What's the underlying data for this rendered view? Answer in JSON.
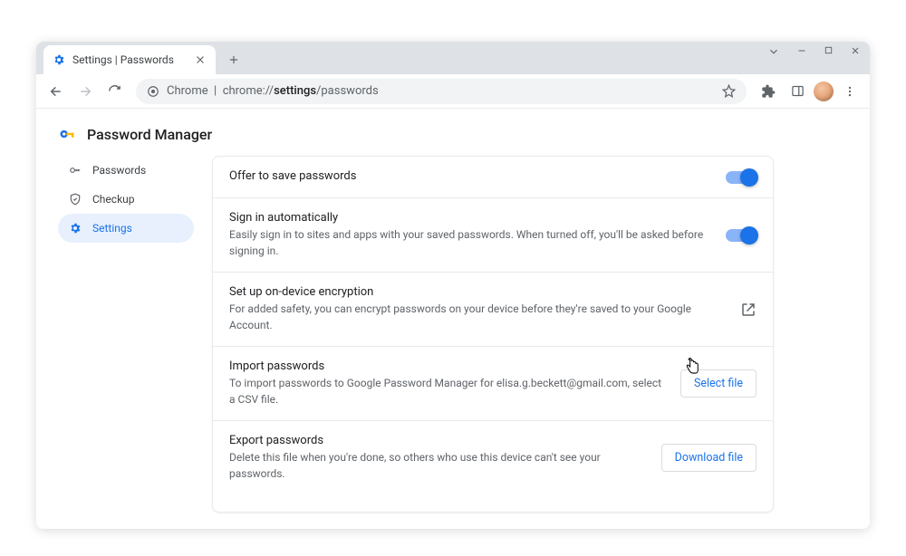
{
  "tab": {
    "title": "Settings | Passwords"
  },
  "omnibox": {
    "scheme": "Chrome",
    "path_prefix": "chrome://",
    "path_bold": "settings",
    "path_suffix": "/passwords"
  },
  "header": {
    "title": "Password Manager"
  },
  "sidebar": {
    "items": [
      {
        "label": "Passwords"
      },
      {
        "label": "Checkup"
      },
      {
        "label": "Settings"
      }
    ]
  },
  "rows": {
    "offer": {
      "title": "Offer to save passwords"
    },
    "auto": {
      "title": "Sign in automatically",
      "sub": "Easily sign in to sites and apps with your saved passwords. When turned off, you'll be asked before signing in."
    },
    "encrypt": {
      "title": "Set up on-device encryption",
      "sub": "For added safety, you can encrypt passwords on your device before they're saved to your Google Account."
    },
    "import": {
      "title": "Import passwords",
      "sub": "To import passwords to Google Password Manager for elisa.g.beckett@gmail.com, select a CSV file.",
      "button": "Select file"
    },
    "export": {
      "title": "Export passwords",
      "sub": "Delete this file when you're done, so others who use this device can't see your passwords.",
      "button": "Download file"
    }
  }
}
